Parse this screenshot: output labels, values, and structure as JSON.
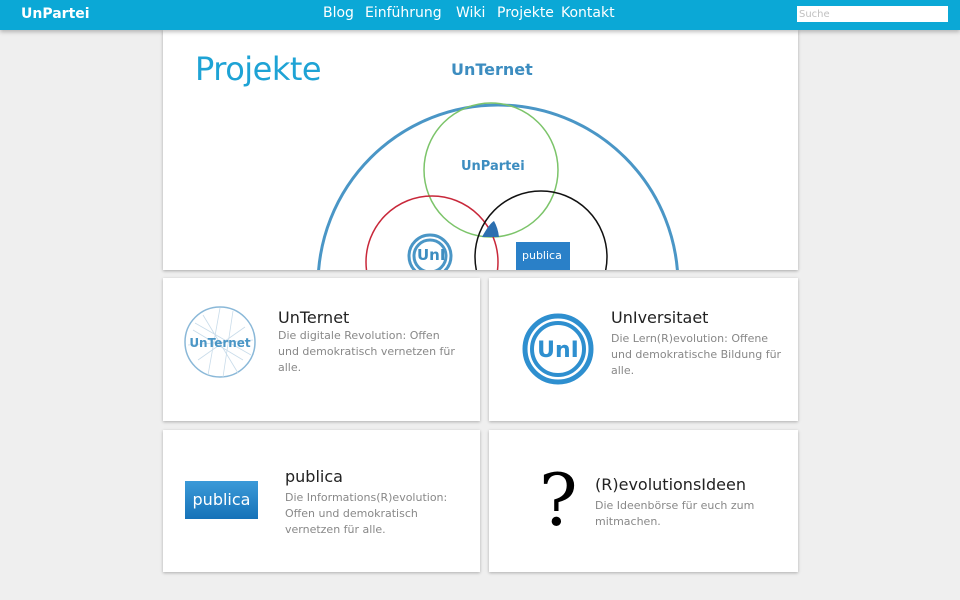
{
  "brand": "UnPartei",
  "nav": [
    "Blog",
    "Einführung",
    "Wiki",
    "Projekte",
    "Kontakt"
  ],
  "search": {
    "placeholder": "Suche"
  },
  "hero": {
    "title": "Projekte",
    "diagram_labels": {
      "outer": "UnTernet",
      "green": "UnPartei",
      "uni": "UnI",
      "publica": "publica"
    }
  },
  "cards": [
    {
      "title": "UnTernet",
      "desc": "Die digitale Revolution: Offen und demokratisch vernetzen für alle.",
      "logo_text": "UnTernet",
      "icon": "unternet-network-icon"
    },
    {
      "title": "UnIversitaet",
      "desc": "Die Lern(R)evolution: Offene und demokratische Bildung für alle.",
      "logo_text": "UnI",
      "icon": "uni-ring-icon"
    },
    {
      "title": "publica",
      "desc": "Die Informations(R)evolution: Offen und demokratisch vernetzen für alle.",
      "logo_text": "publica",
      "icon": "publica-logo-icon"
    },
    {
      "title": "(R)evolutionsIdeen",
      "desc": "Die Ideenbörse für euch zum mitmachen.",
      "logo_text": "?",
      "icon": "question-mark-icon"
    }
  ],
  "colors": {
    "topbar": "#0ba8d6",
    "accent": "#1ea3d5",
    "outer_circle": "#4a96c6",
    "green_circle": "#7cc46a",
    "red_circle": "#c8283a",
    "black_circle": "#111111"
  }
}
